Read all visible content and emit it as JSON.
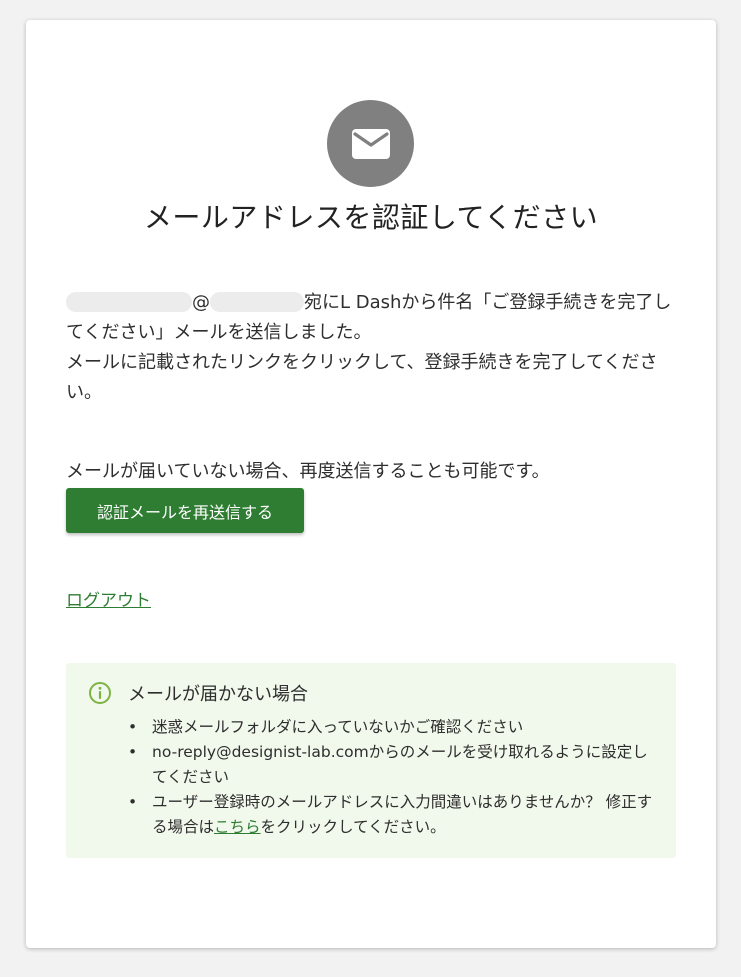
{
  "page": {
    "title": "メールアドレスを認証してください",
    "icon": "mail-icon"
  },
  "message": {
    "address_at": "@",
    "line_rest": "宛にL Dashから件名「ご登録手続きを完了してください」メールを送信しました。",
    "instruction": "メールに記載されたリンクをクリックして、登録手続きを完了してください。"
  },
  "resend": {
    "text": "メールが届いていない場合、再度送信することも可能です。",
    "button_label": "認証メールを再送信する"
  },
  "logout": {
    "label": "ログアウト"
  },
  "notice": {
    "icon": "info-icon",
    "title": "メールが届かない場合",
    "items": [
      "迷惑メールフォルダに入っていないかご確認ください",
      "no-reply@designist-lab.comからのメールを受け取れるように設定してください"
    ],
    "last_item_before": "ユーザー登録時のメールアドレスに入力間違いはありませんか？ 修正する場合は",
    "last_item_link": "こちら",
    "last_item_after": "をクリックしてください。"
  },
  "colors": {
    "primary": "#2e7d32",
    "icon_circle": "#808080",
    "notice_bg": "#f1f8ec",
    "info_icon": "#7cb342"
  }
}
